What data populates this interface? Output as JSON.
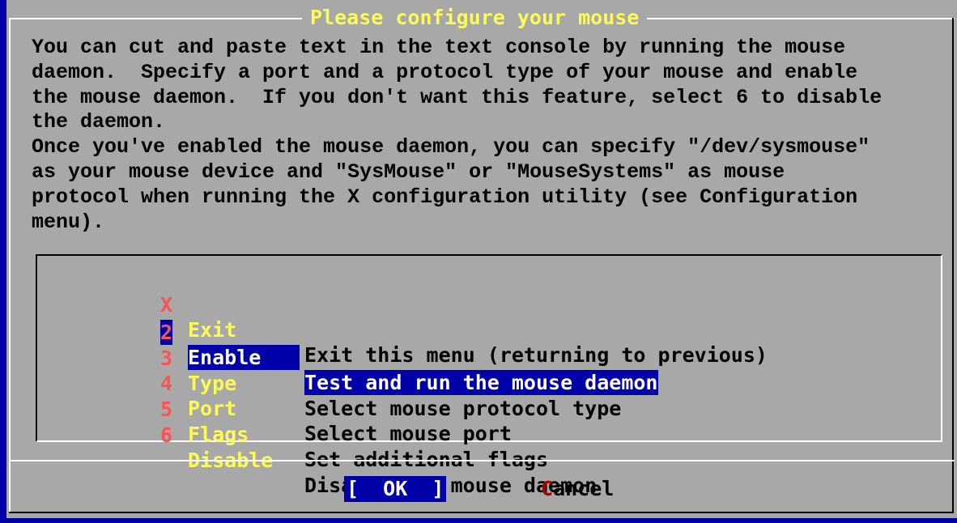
{
  "dialog": {
    "title": "Please configure your mouse",
    "prompt": "You can cut and paste text in the text console by running the mouse\ndaemon.  Specify a port and a protocol type of your mouse and enable\nthe mouse daemon.  If you don't want this feature, select 6 to disable\nthe daemon.\nOnce you've enabled the mouse daemon, you can specify \"/dev/sysmouse\"\nas your mouse device and \"SysMouse\" or \"MouseSystems\" as mouse\nprotocol when running the X configuration utility (see Configuration\nmenu)."
  },
  "menu": {
    "items": [
      {
        "key": "X",
        "name": "Exit",
        "desc": "Exit this menu (returning to previous)"
      },
      {
        "key": "2",
        "name": "Enable",
        "desc": "Test and run the mouse daemon",
        "selected": true
      },
      {
        "key": "3",
        "name": "Type",
        "desc": "Select mouse protocol type"
      },
      {
        "key": "4",
        "name": "Port",
        "desc": "Select mouse port"
      },
      {
        "key": "5",
        "name": "Flags",
        "desc": "Set additional flags"
      },
      {
        "key": "6",
        "name": "Disable",
        "desc": "Disable the mouse daemon"
      }
    ]
  },
  "buttons": {
    "ok_label": "[  OK  ]",
    "cancel_hotkey": "C",
    "cancel_rest": "ancel"
  },
  "colors": {
    "background": "#0000a8",
    "dialog": "#a8a8a8",
    "title": "#fcfc54",
    "hotkey": "#fc5454",
    "highlight": "#0000a8"
  }
}
